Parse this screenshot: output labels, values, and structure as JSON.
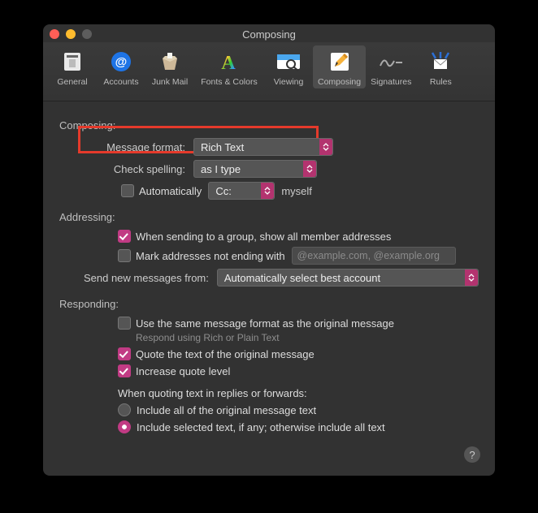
{
  "window_title": "Composing",
  "toolbar": [
    {
      "label": "General"
    },
    {
      "label": "Accounts"
    },
    {
      "label": "Junk Mail"
    },
    {
      "label": "Fonts & Colors"
    },
    {
      "label": "Viewing"
    },
    {
      "label": "Composing"
    },
    {
      "label": "Signatures"
    },
    {
      "label": "Rules"
    }
  ],
  "composing": {
    "header": "Composing:",
    "message_format_label": "Message format:",
    "message_format_value": "Rich Text",
    "check_spelling_label": "Check spelling:",
    "check_spelling_value": "as I type",
    "automatically_label": "Automatically",
    "cc_value": "Cc:",
    "myself": "myself"
  },
  "addressing": {
    "header": "Addressing:",
    "group_label": "When sending to a group, show all member addresses",
    "mark_label": "Mark addresses not ending with",
    "mark_placeholder": "@example.com, @example.org",
    "send_from_label": "Send new messages from:",
    "send_from_value": "Automatically select best account"
  },
  "responding": {
    "header": "Responding:",
    "same_format_label": "Use the same message format as the original message",
    "same_format_hint": "Respond using Rich or Plain Text",
    "quote_label": "Quote the text of the original message",
    "increase_label": "Increase quote level",
    "quoting_header": "When quoting text in replies or forwards:",
    "include_all_label": "Include all of the original message text",
    "include_sel_label": "Include selected text, if any; otherwise include all text"
  },
  "help": "?"
}
